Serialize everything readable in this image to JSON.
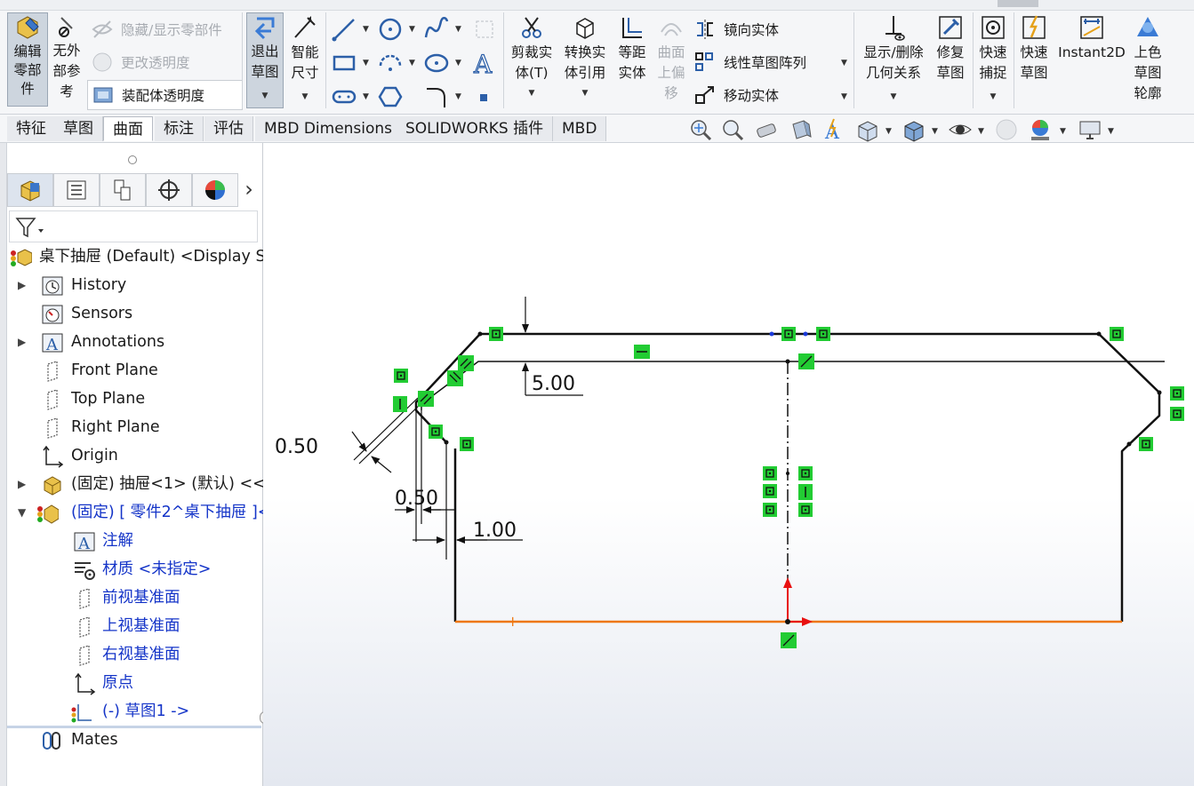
{
  "ribbon": {
    "edit_part": {
      "line1": "编辑",
      "line2": "零部",
      "line3": "件"
    },
    "no_external_refs": {
      "line1": "无外",
      "line2": "部参",
      "line3": "考"
    },
    "hide_show_parts": "隐藏/显示零部件",
    "change_transparency": "更改透明度",
    "assembly_transparency": "装配体透明度",
    "exit_sketch": {
      "line1": "退出",
      "line2": "草图"
    },
    "smart_dimension": {
      "line1": "智能",
      "line2": "尺寸"
    },
    "trim_entities": {
      "line1": "剪裁实",
      "line2": "体(T)"
    },
    "convert_entities": {
      "line1": "转换实",
      "line2": "体引用"
    },
    "offset_entities": {
      "line1": "等距",
      "line2": "实体"
    },
    "surface_offset": {
      "line1": "曲面",
      "line2": "上偏",
      "line3": "移"
    },
    "mirror_entities": "镜向实体",
    "linear_pattern": "线性草图阵列",
    "move_entities": "移动实体",
    "display_relations": {
      "line1": "显示/删除",
      "line2": "几何关系"
    },
    "repair_sketch": {
      "line1": "修复",
      "line2": "草图"
    },
    "quick_snaps": {
      "line1": "快速",
      "line2": "捕捉"
    },
    "rapid_sketch": {
      "line1": "快速",
      "line2": "草图"
    },
    "instant2d": "Instant2D",
    "shaded_contours": {
      "line1": "上色",
      "line2": "草图",
      "line3": "轮廓"
    }
  },
  "tabs": [
    "特征",
    "草图",
    "曲面",
    "标注",
    "评估",
    "MBD Dimensions",
    "SOLIDWORKS 插件",
    "MBD"
  ],
  "active_tab": "曲面",
  "tree": {
    "root": "桌下抽屉 (Default) <Display S",
    "history": "History",
    "sensors": "Sensors",
    "annotations": "Annotations",
    "front_plane": "Front Plane",
    "top_plane": "Top Plane",
    "right_plane": "Right Plane",
    "origin": "Origin",
    "drawer": "(固定) 抽屉<1> (默认) <<",
    "part2": "(固定) [ 零件2^桌下抽屉 ]<",
    "notes": "注解",
    "material": "材质 <未指定>",
    "front_datum": "前视基准面",
    "top_datum": "上视基准面",
    "right_datum": "右视基准面",
    "origin_cn": "原点",
    "sketch1": "(-) 草图1 ->",
    "mates": "Mates"
  },
  "dimensions": {
    "d_top": "5.00",
    "d_chamfer": "0.50",
    "d_gap": "0.50",
    "d_wall": "1.00"
  },
  "colors": {
    "relation_green": "#22cc33",
    "axis_red": "#e81010",
    "sketch_orange": "#ee7711",
    "link_blue": "#1434c8"
  }
}
